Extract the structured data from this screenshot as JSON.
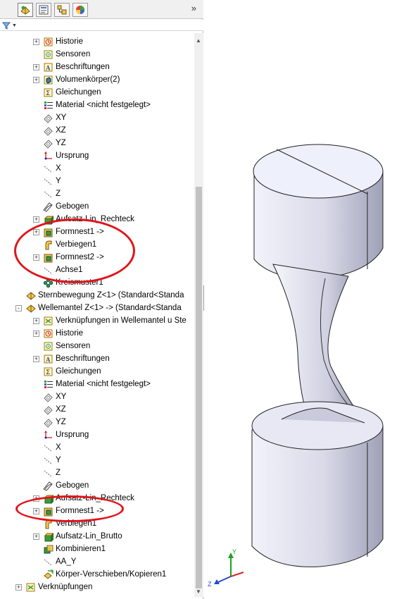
{
  "tabs": {
    "items": [
      {
        "name": "feature-manager-tab-icon",
        "active": true
      },
      {
        "name": "property-manager-tab-icon",
        "active": false
      },
      {
        "name": "configuration-manager-tab-icon",
        "active": false
      },
      {
        "name": "display-manager-tab-icon",
        "active": false
      }
    ],
    "more": "»"
  },
  "filter": {
    "icon": "filter-icon"
  },
  "tree": [
    {
      "label": "Historie",
      "icon": "history-icon",
      "level": 1,
      "expander": "+"
    },
    {
      "label": "Sensoren",
      "icon": "sensor-icon",
      "level": 1,
      "expander": ""
    },
    {
      "label": "Beschriftungen",
      "icon": "annotation-icon",
      "level": 1,
      "expander": "+"
    },
    {
      "label": "Volumenkörper(2)",
      "icon": "solid-bodies-icon",
      "level": 1,
      "expander": "+"
    },
    {
      "label": "Gleichungen",
      "icon": "equations-icon",
      "level": 1,
      "expander": ""
    },
    {
      "label": "Material <nicht festgelegt>",
      "icon": "material-icon",
      "level": 1,
      "expander": ""
    },
    {
      "label": "XY",
      "icon": "plane-icon",
      "level": 1,
      "expander": ""
    },
    {
      "label": "XZ",
      "icon": "plane-icon",
      "level": 1,
      "expander": ""
    },
    {
      "label": "YZ",
      "icon": "plane-icon",
      "level": 1,
      "expander": ""
    },
    {
      "label": "Ursprung",
      "icon": "origin-icon",
      "level": 1,
      "expander": ""
    },
    {
      "label": "X",
      "icon": "axis-icon",
      "level": 1,
      "expander": ""
    },
    {
      "label": "Y",
      "icon": "axis-icon",
      "level": 1,
      "expander": ""
    },
    {
      "label": "Z",
      "icon": "axis-icon",
      "level": 1,
      "expander": ""
    },
    {
      "label": "Gebogen",
      "icon": "sketch-icon",
      "level": 1,
      "expander": ""
    },
    {
      "label": "Aufsatz-Lin_Rechteck",
      "icon": "extrude-icon",
      "level": 1,
      "expander": "+"
    },
    {
      "label": "Formnest1 ->",
      "icon": "cavity-icon",
      "level": 1,
      "expander": "+"
    },
    {
      "label": "Verbiegen1",
      "icon": "flex-icon",
      "level": 1,
      "expander": ""
    },
    {
      "label": "Formnest2 ->",
      "icon": "cavity-icon",
      "level": 1,
      "expander": "+"
    },
    {
      "label": "Achse1",
      "icon": "axis-icon",
      "level": 1,
      "expander": ""
    },
    {
      "label": "Kreismuster1",
      "icon": "circular-pattern-icon",
      "level": 1,
      "expander": ""
    },
    {
      "label": "Sternbewegung Z<1> (Standard<Standa",
      "icon": "part-icon",
      "level": 0,
      "expander": ""
    },
    {
      "label": "Wellemantel Z<1> -> (Standard<Standa",
      "icon": "part-icon",
      "level": 0,
      "expander": "-"
    },
    {
      "label": "Verknüpfungen in Wellemantel u Ste",
      "icon": "mates-icon",
      "level": 1,
      "expander": "+"
    },
    {
      "label": "Historie",
      "icon": "history-icon",
      "level": 1,
      "expander": "+"
    },
    {
      "label": "Sensoren",
      "icon": "sensor-icon",
      "level": 1,
      "expander": ""
    },
    {
      "label": "Beschriftungen",
      "icon": "annotation-icon",
      "level": 1,
      "expander": "+"
    },
    {
      "label": "Gleichungen",
      "icon": "equations-icon",
      "level": 1,
      "expander": ""
    },
    {
      "label": "Material <nicht festgelegt>",
      "icon": "material-icon",
      "level": 1,
      "expander": ""
    },
    {
      "label": "XY",
      "icon": "plane-icon",
      "level": 1,
      "expander": ""
    },
    {
      "label": "XZ",
      "icon": "plane-icon",
      "level": 1,
      "expander": ""
    },
    {
      "label": "YZ",
      "icon": "plane-icon",
      "level": 1,
      "expander": ""
    },
    {
      "label": "Ursprung",
      "icon": "origin-icon",
      "level": 1,
      "expander": ""
    },
    {
      "label": "X",
      "icon": "axis-icon",
      "level": 1,
      "expander": ""
    },
    {
      "label": "Y",
      "icon": "axis-icon",
      "level": 1,
      "expander": ""
    },
    {
      "label": "Z",
      "icon": "axis-icon",
      "level": 1,
      "expander": ""
    },
    {
      "label": "Gebogen",
      "icon": "sketch-icon",
      "level": 1,
      "expander": ""
    },
    {
      "label": "Aufsatz-Lin_Rechteck",
      "icon": "extrude-icon",
      "level": 1,
      "expander": "+"
    },
    {
      "label": "Formnest1 ->",
      "icon": "cavity-icon",
      "level": 1,
      "expander": "+"
    },
    {
      "label": "Verbiegen1",
      "icon": "flex-icon",
      "level": 1,
      "expander": ""
    },
    {
      "label": "Aufsatz-Lin_Brutto",
      "icon": "extrude-icon",
      "level": 1,
      "expander": "+"
    },
    {
      "label": "Kombinieren1",
      "icon": "combine-icon",
      "level": 1,
      "expander": ""
    },
    {
      "label": "AA_Y",
      "icon": "axis-icon",
      "level": 1,
      "expander": ""
    },
    {
      "label": "Körper-Verschieben/Kopieren1",
      "icon": "move-copy-body-icon",
      "level": 1,
      "expander": ""
    },
    {
      "label": "Verknüpfungen",
      "icon": "mates-icon",
      "level": 0,
      "expander": "+"
    }
  ],
  "triad": {
    "y": "Y",
    "z": "Z"
  },
  "colors": {
    "highlight_oval": "#e0141b",
    "part_surface": "#e8e8f4",
    "part_shadow": "#aeb0c4",
    "viewport_bg": "#ffffff"
  }
}
